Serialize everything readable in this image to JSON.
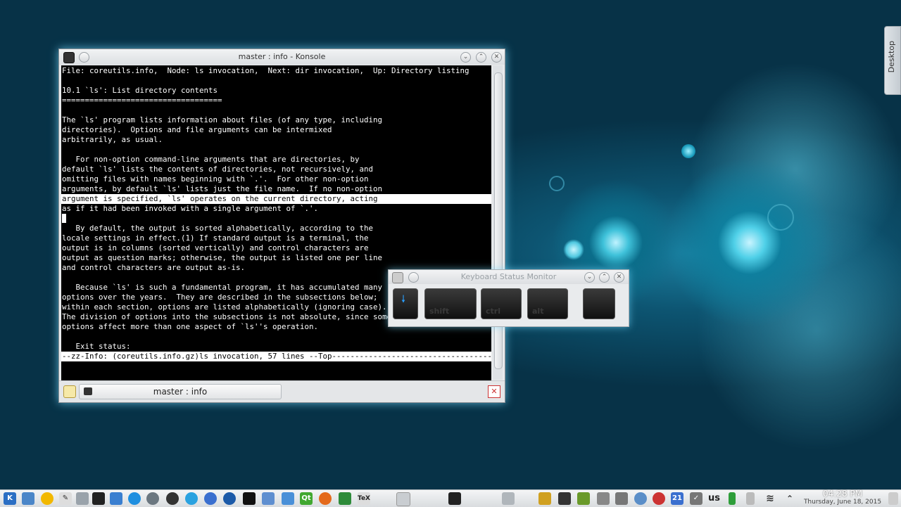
{
  "desktop": {
    "tab_label": "Desktop"
  },
  "konsole": {
    "title": "master : info - Konsole",
    "tab_label": "master : info",
    "lines": [
      {
        "text": "File: coreutils.info,  Node: ls invocation,  Next: dir invocation,  Up: Directory listing",
        "hl": false
      },
      {
        "text": "",
        "hl": false
      },
      {
        "text": "10.1 `ls': List directory contents",
        "hl": false
      },
      {
        "text": "===================================",
        "hl": false
      },
      {
        "text": "",
        "hl": false
      },
      {
        "text": "The `ls' program lists information about files (of any type, including",
        "hl": false
      },
      {
        "text": "directories).  Options and file arguments can be intermixed",
        "hl": false
      },
      {
        "text": "arbitrarily, as usual.",
        "hl": false
      },
      {
        "text": "",
        "hl": false
      },
      {
        "text": "   For non-option command-line arguments that are directories, by",
        "hl": false
      },
      {
        "text": "default `ls' lists the contents of directories, not recursively, and",
        "hl": false
      },
      {
        "text": "omitting files with names beginning with `.'.  For other non-option",
        "hl": false
      },
      {
        "text": "arguments, by default `ls' lists just the file name.  If no non-option",
        "hl": false
      },
      {
        "text": "argument is specified, `ls' operates on the current directory, acting",
        "hl": true
      },
      {
        "text": "as if it had been invoked with a single argument of `.'.",
        "hl": false
      },
      {
        "text": "",
        "hl": false,
        "cursor": true
      },
      {
        "text": "   By default, the output is sorted alphabetically, according to the",
        "hl": false
      },
      {
        "text": "locale settings in effect.(1) If standard output is a terminal, the",
        "hl": false
      },
      {
        "text": "output is in columns (sorted vertically) and control characters are",
        "hl": false
      },
      {
        "text": "output as question marks; otherwise, the output is listed one per line",
        "hl": false
      },
      {
        "text": "and control characters are output as-is.",
        "hl": false
      },
      {
        "text": "",
        "hl": false
      },
      {
        "text": "   Because `ls' is such a fundamental program, it has accumulated many",
        "hl": false
      },
      {
        "text": "options over the years.  They are described in the subsections below;",
        "hl": false
      },
      {
        "text": "within each section, options are listed alphabetically (ignoring case).",
        "hl": false
      },
      {
        "text": "The division of options into the subsections is not absolute, since some",
        "hl": false
      },
      {
        "text": "options affect more than one aspect of `ls''s operation.",
        "hl": false
      },
      {
        "text": "",
        "hl": false
      },
      {
        "text": "   Exit status:",
        "hl": false
      },
      {
        "text": "--zz-Info: (coreutils.info.gz)ls invocation, 57 lines --Top------------------------------------",
        "hl": true
      }
    ]
  },
  "keyboard_monitor": {
    "title": "Keyboard Status Monitor",
    "keys": [
      "shift",
      "ctrl",
      "alt"
    ]
  },
  "taskbar": {
    "keyboard_layout": "us",
    "calendar_day": "21",
    "time": "04:28 PM",
    "date": "Thursday, June 18, 2015"
  }
}
